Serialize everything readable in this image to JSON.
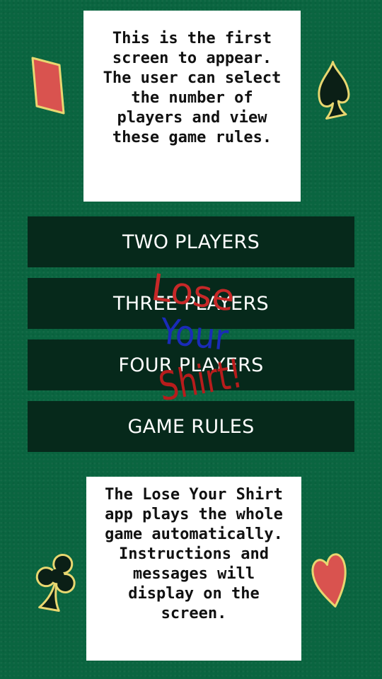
{
  "intro_text": "This is the first screen to appear. The user can select the number of players and view these game rules.",
  "menu": {
    "two_players": "TWO PLAYERS",
    "three_players": "THREE PLAYERS",
    "four_players": "FOUR PLAYERS",
    "game_rules": "GAME RULES"
  },
  "logo": {
    "line1": "Lose",
    "line2": "Your",
    "line3": "Shirt!"
  },
  "footer_text": "The Lose Your Shirt app plays the whole game automatically. Instructions and messages will display on the screen.",
  "colors": {
    "felt": "#0a6540",
    "button": "#06291b",
    "logo_red": "#c62828",
    "logo_blue": "#1a2bb8",
    "suit_red": "#d9534f",
    "suit_gold": "#e8d770"
  },
  "icons": [
    "diamond-icon",
    "spade-icon",
    "club-icon",
    "heart-icon"
  ]
}
